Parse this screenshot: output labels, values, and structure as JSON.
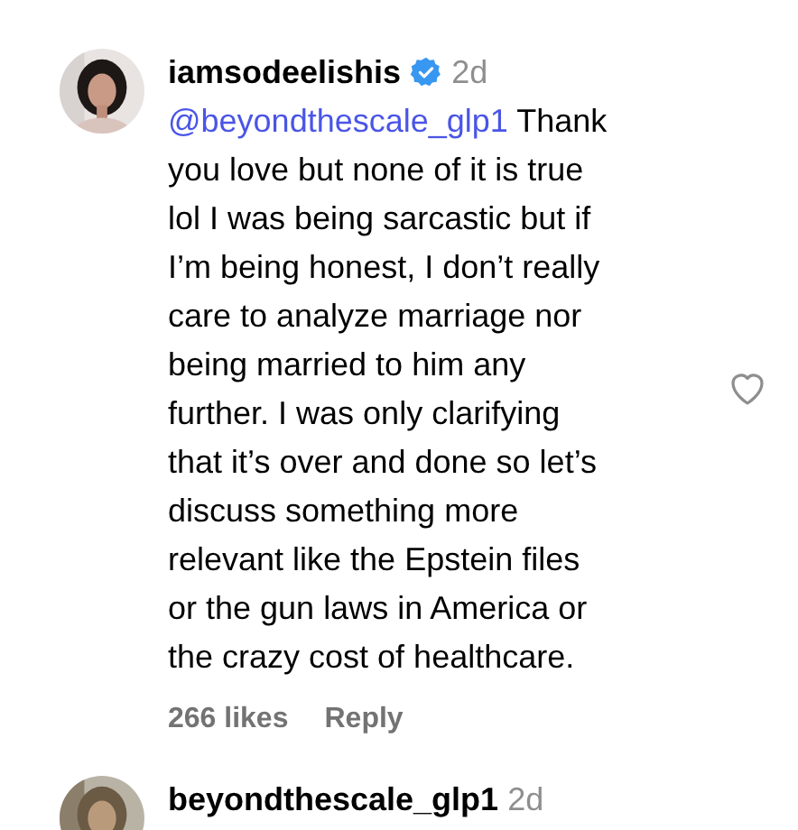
{
  "comments": [
    {
      "username": "iamsodeelishis",
      "verified": true,
      "time": "2d",
      "mention": "@beyondthescale_glp1",
      "text": " Thank\nyou love but none of it is true\nlol I was being sarcastic but if\nI’m being honest, I don’t really\ncare to analyze marriage nor\nbeing married to him any\nfurther. I was only clarifying\nthat it’s over and done so let’s\ndiscuss something more\nrelevant like the Epstein files\nor the gun laws in America or\nthe crazy cost of healthcare.",
      "likes": "266 likes",
      "reply": "Reply",
      "liked": false
    },
    {
      "username": "beyondthescale_glp1",
      "time": "2d"
    }
  ]
}
